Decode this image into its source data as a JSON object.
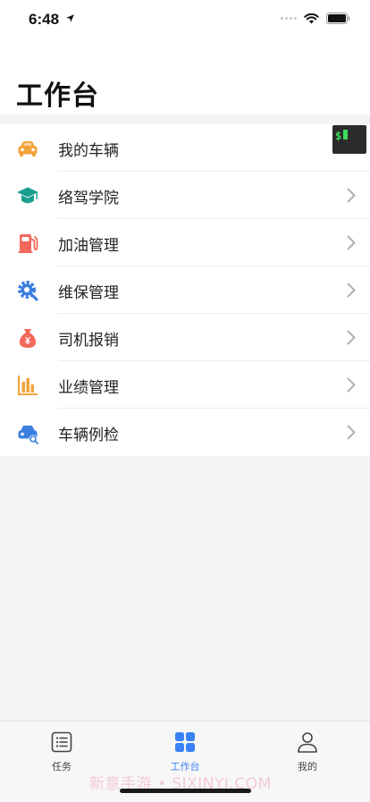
{
  "status_bar": {
    "time": "6:48"
  },
  "header": {
    "title": "工作台"
  },
  "menu": {
    "items": [
      {
        "label": "我的车辆"
      },
      {
        "label": "络驾学院"
      },
      {
        "label": "加油管理"
      },
      {
        "label": "维保管理"
      },
      {
        "label": "司机报销"
      },
      {
        "label": "业绩管理"
      },
      {
        "label": "车辆例检"
      }
    ]
  },
  "tabbar": {
    "tabs": [
      {
        "label": "任务"
      },
      {
        "label": "工作台"
      },
      {
        "label": "我的"
      }
    ],
    "active": "工作台"
  },
  "watermark": "新意手游 • SIXINYI.COM",
  "colors": {
    "accent": "#3b82f6",
    "orange": "#f2a33a",
    "teal": "#1a9e8f",
    "red": "#f2685a",
    "blue": "#3b7fe0"
  }
}
